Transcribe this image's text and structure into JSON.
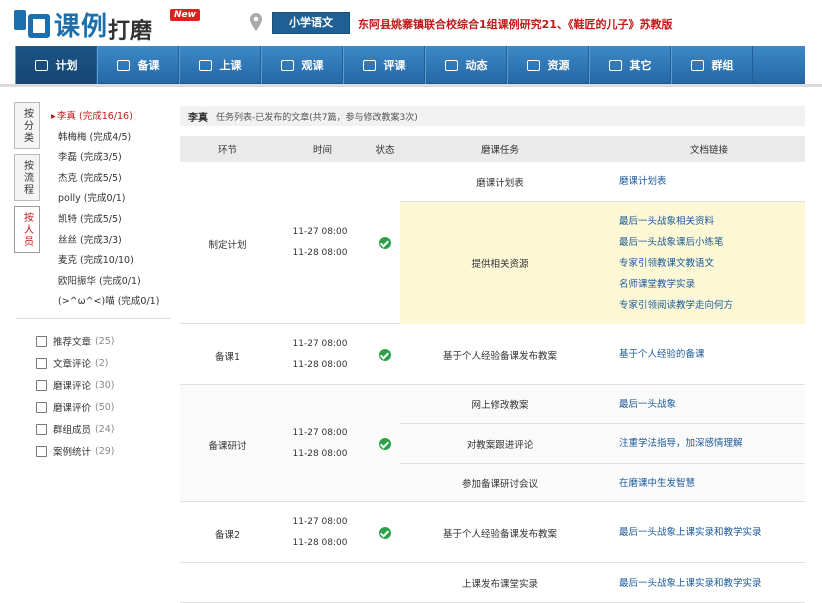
{
  "header": {
    "logo_text_1": "课例",
    "logo_text_2": "打磨",
    "new_badge": "New",
    "subject_button": "小学语文",
    "course_title": "东阿县姚寨镇联合校综合1组课例研究21、《鞋匠的儿子》苏教版"
  },
  "nav": {
    "items": [
      {
        "label": "计划",
        "icon": "calendar-icon"
      },
      {
        "label": "备课",
        "icon": "book-icon"
      },
      {
        "label": "上课",
        "icon": "projector-icon"
      },
      {
        "label": "观课",
        "icon": "people-icon"
      },
      {
        "label": "评课",
        "icon": "document-icon"
      },
      {
        "label": "动态",
        "icon": "document-icon"
      },
      {
        "label": "资源",
        "icon": "document-icon"
      },
      {
        "label": "其它",
        "icon": "document-icon"
      },
      {
        "label": "群组",
        "icon": "cards-icon"
      }
    ]
  },
  "sidebar": {
    "tabs": [
      "按分类",
      "按流程",
      "按人员"
    ],
    "people": [
      "李真 (完成16/16)",
      "韩梅梅 (完成4/5)",
      "李磊 (完成3/5)",
      "杰克 (完成5/5)",
      "polly (完成0/1)",
      "凯特 (完成5/5)",
      "丝丝 (完成3/3)",
      "麦克 (完成10/10)",
      "欧阳振华 (完成0/1)",
      "(>^ω^<)喵 (完成0/1)"
    ],
    "stats": [
      {
        "label": "推荐文章",
        "count": "(25)"
      },
      {
        "label": "文章评论",
        "count": "(2)"
      },
      {
        "label": "磨课评论",
        "count": "(30)"
      },
      {
        "label": "磨课评价",
        "count": "(50)"
      },
      {
        "label": "群组成员",
        "count": "(24)"
      },
      {
        "label": "案例统计",
        "count": "(29)"
      }
    ]
  },
  "main": {
    "user": "李真",
    "subtitle": "任务列表-已发布的文章(共7篇，参与修改教案3次)",
    "columns": [
      "环节",
      "时间",
      "状态",
      "磨课任务",
      "文档链接"
    ],
    "rows": [
      {
        "stage": "制定计划",
        "time_start": "11-27 08:00",
        "time_end": "11-28 08:00",
        "tasks": [
          {
            "task": "磨课计划表",
            "links": [
              "磨课计划表"
            ]
          },
          {
            "task": "提供相关资源",
            "links": [
              "最后一头战象相关资料",
              "最后一头战象课后小练笔",
              "专家引领教课文教语文",
              "名师课堂教学实录",
              "专家引领阅读教学走向何方"
            ]
          }
        ]
      },
      {
        "stage": "备课1",
        "time_start": "11-27 08:00",
        "time_end": "11-28 08:00",
        "tasks": [
          {
            "task": "基于个人经验备课发布教案",
            "links": [
              "基于个人经验的备课"
            ]
          }
        ]
      },
      {
        "stage": "备课研讨",
        "time_start": "11-27 08:00",
        "time_end": "11-28 08:00",
        "tasks": [
          {
            "task": "网上修改教案",
            "links": [
              "最后一头战象"
            ]
          },
          {
            "task": "对教案跟进评论",
            "links": [
              "注重学法指导，加深感情理解"
            ]
          },
          {
            "task": "参加备课研讨会议",
            "links": [
              "在磨课中生发智慧"
            ]
          }
        ]
      },
      {
        "stage": "备课2",
        "time_start": "11-27 08:00",
        "time_end": "11-28 08:00",
        "tasks": [
          {
            "task": "基于个人经验备课发布教案",
            "links": [
              "最后一头战象上课实录和教学实录"
            ]
          }
        ]
      },
      {
        "stage": "",
        "time_start": "",
        "time_end": "",
        "tasks": [
          {
            "task": "上课发布课堂实录",
            "links": [
              "最后一头战象上课实录和教学实录"
            ]
          }
        ]
      }
    ]
  }
}
